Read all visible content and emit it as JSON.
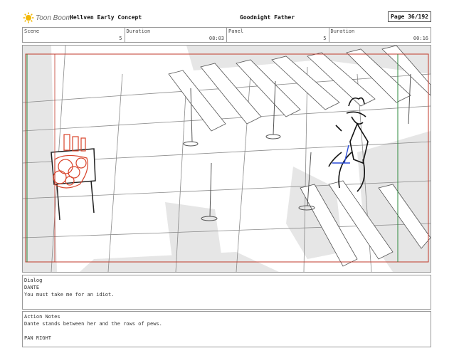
{
  "header": {
    "logo_text": "Toon Boom",
    "project": "Hellven  Early Concept",
    "title": "Goodnight Father",
    "page_label": "Page",
    "page_value": "36/192"
  },
  "info": {
    "scene": {
      "label": "Scene",
      "value": "5"
    },
    "duration1": {
      "label": "Duration",
      "value": "08:03"
    },
    "panel": {
      "label": "Panel",
      "value": "5"
    },
    "duration2": {
      "label": "Duration",
      "value": "00:16"
    }
  },
  "dialog": {
    "label": "Dialog",
    "speaker": "DANTE",
    "line": "You must take me for an idiot."
  },
  "action_notes": {
    "label": "Action Notes",
    "line1": "Dante stands between her and the rows of pews.",
    "line2": "PAN RIGHT"
  },
  "colors": {
    "camera_frame": "#c0392b",
    "safe_frame": "#2e8b3d",
    "red_sketch": "#d8432a",
    "blue_sketch": "#2a4bd8"
  }
}
